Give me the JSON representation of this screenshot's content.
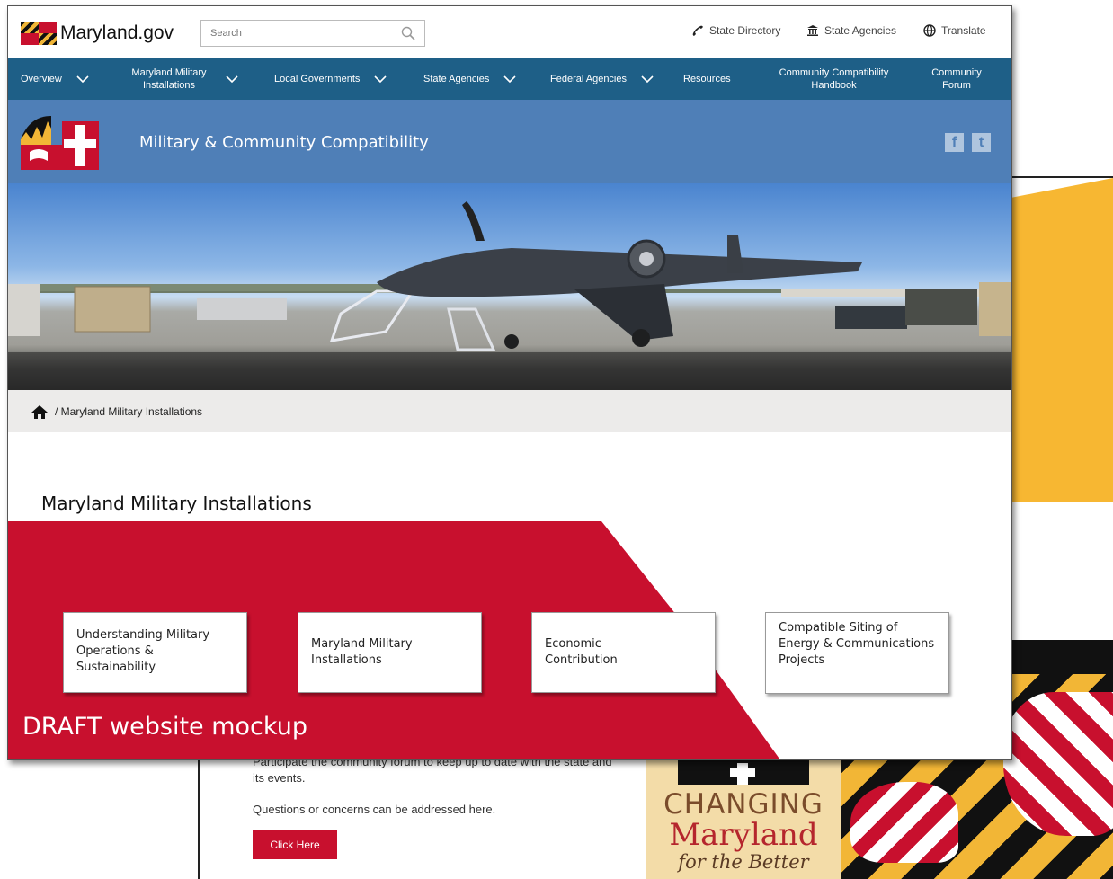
{
  "site": {
    "logo_text": "Maryland.gov"
  },
  "search": {
    "placeholder": "Search"
  },
  "utility_links": [
    {
      "label": "State Directory",
      "icon": "phone-icon"
    },
    {
      "label": "State Agencies",
      "icon": "building-icon"
    },
    {
      "label": "Translate",
      "icon": "globe-icon"
    }
  ],
  "nav": [
    {
      "label": "Overview",
      "dropdown": true
    },
    {
      "label": "Maryland Military Installations",
      "dropdown": true
    },
    {
      "label": "Local Governments",
      "dropdown": true
    },
    {
      "label": "State Agencies",
      "dropdown": true
    },
    {
      "label": "Federal Agencies",
      "dropdown": true
    },
    {
      "label": "Resources",
      "dropdown": false
    },
    {
      "label": "Community Compatibility Handbook",
      "dropdown": false
    },
    {
      "label": "Community Forum",
      "dropdown": false
    }
  ],
  "band": {
    "title": "Military & Community Compatibility",
    "social": [
      "f",
      "t"
    ]
  },
  "breadcrumb": {
    "current": "/ Maryland Military Installations"
  },
  "main": {
    "heading": "Maryland Military Installations",
    "cards": [
      "Understanding Military Operations & Sustainability",
      "Maryland Military Installations",
      "Economic Contribution",
      "Compatible Siting of Energy & Communications Projects"
    ],
    "draft_label": "DRAFT website mockup"
  },
  "background_page": {
    "text1": "Participate the community forum to keep up to date with the state and",
    "text2": "its events.",
    "text3": "Questions or concerns can be addressed here.",
    "button": "Click Here",
    "changing": {
      "line1": "CHANGING",
      "line2": "Maryland",
      "line3": "for the Better"
    }
  },
  "colors": {
    "nav_blue": "#1e5f87",
    "band_blue": "#4f7fb7",
    "maryland_red": "#c8102e",
    "maryland_gold": "#f2b636"
  }
}
